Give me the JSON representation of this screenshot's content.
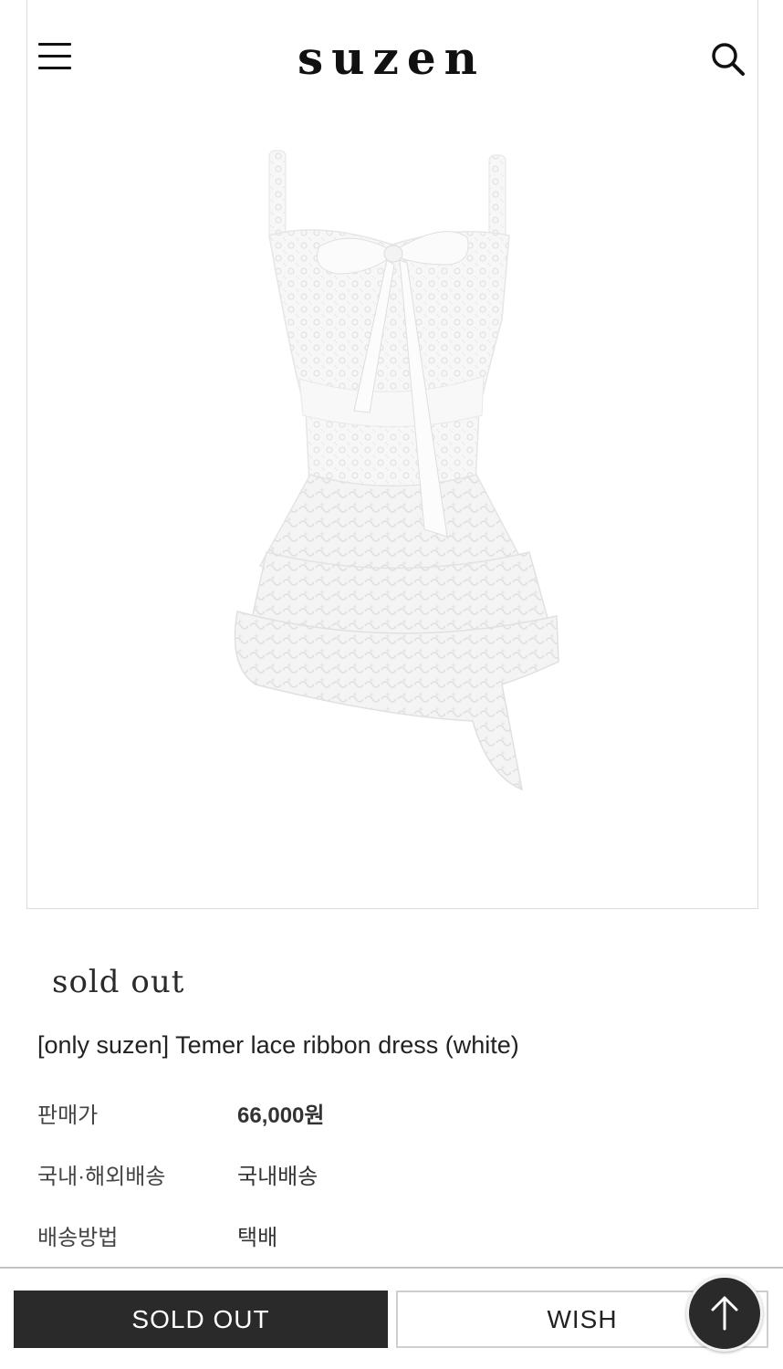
{
  "header": {
    "logo": "suzen",
    "menu_icon": "hamburger-menu-icon",
    "search_icon": "search-icon"
  },
  "product": {
    "image_icon": "white-lace-ribbon-dress",
    "sold_out_tag": "sold out",
    "name": "[only suzen] Temer lace ribbon dress (white)",
    "info": [
      {
        "label": "판매가",
        "value": "66,000원"
      },
      {
        "label": "국내·해외배송",
        "value": "국내배송"
      },
      {
        "label": "배송방법",
        "value": "택배"
      }
    ]
  },
  "actions": {
    "sold_out_label": "SOLD OUT",
    "wish_label": "WISH",
    "top_icon": "arrow-up-icon"
  },
  "colors": {
    "dark_button": "#2a2a2a",
    "border": "#dcdcdc",
    "text": "#222222"
  }
}
